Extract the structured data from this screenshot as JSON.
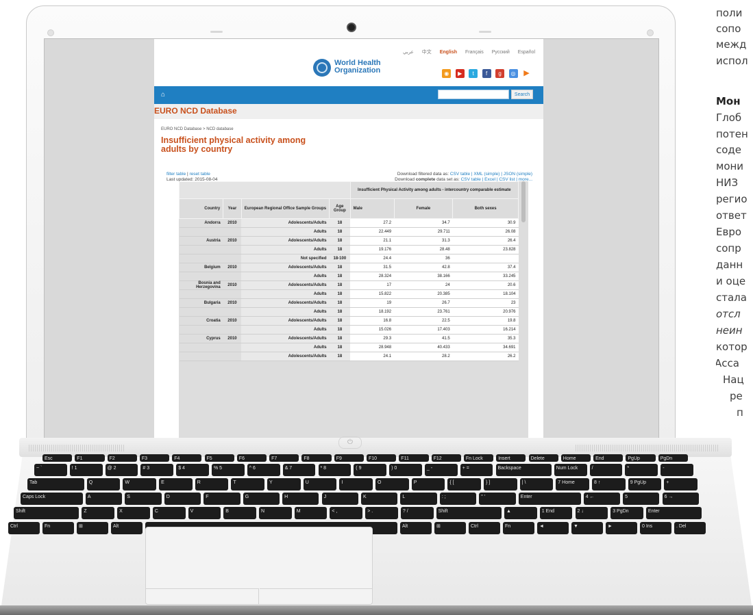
{
  "laptop": {
    "power_glyph": "⏻"
  },
  "site": {
    "languages": [
      "عربي",
      "中文",
      "English",
      "Français",
      "Русский",
      "Español"
    ],
    "active_language": "English",
    "logo_line1": "World Health",
    "logo_line2": "Organization",
    "search_placeholder": "",
    "search_button": "Search",
    "section_title": "EURO NCD Database"
  },
  "content": {
    "breadcrumb_1": "EURO NCD Database",
    "breadcrumb_sep": ">",
    "breadcrumb_2": "NCD database",
    "title": "Insufficient physical activity among adults by country",
    "filter_link": "filter table",
    "reset_link": "reset table",
    "last_updated": "Last updated: 2015-08-04",
    "download_filtered_label": "Download filtered data as:",
    "download_filtered_links": "CSV table | XML (simple) | JSON (simple)",
    "download_complete_label_pre": "Download ",
    "download_complete_bold": "complete",
    "download_complete_label_post": " data set as:",
    "download_complete_links": "CSV table | Excel | CSV list | more..."
  },
  "table": {
    "group_header": "Insufficient Physical Activity among adults - intercountry comparable estimate",
    "headers": [
      "Country",
      "Year",
      "European Regional Office Sample Groups",
      "Age Group",
      "Male",
      "Female",
      "Both sexes"
    ],
    "rows": [
      {
        "country": "Andorra",
        "year": "2010",
        "group": "Adolescents/Adults",
        "age": "18",
        "male": "27.2",
        "female": "34.7",
        "both": "30.9"
      },
      {
        "country": "",
        "year": "",
        "group": "Adults",
        "age": "18",
        "male": "22.449",
        "female": "29.711",
        "both": "26.08"
      },
      {
        "country": "Austria",
        "year": "2010",
        "group": "Adolescents/Adults",
        "age": "18",
        "male": "21.1",
        "female": "31.3",
        "both": "26.4"
      },
      {
        "country": "",
        "year": "",
        "group": "Adults",
        "age": "18",
        "male": "19.176",
        "female": "28.48",
        "both": "23.828"
      },
      {
        "country": "",
        "year": "",
        "group": "Not specified",
        "age": "18-100",
        "male": "24.4",
        "female": "36",
        "both": ""
      },
      {
        "country": "Belgium",
        "year": "2010",
        "group": "Adolescents/Adults",
        "age": "18",
        "male": "31.5",
        "female": "42.8",
        "both": "37.4"
      },
      {
        "country": "",
        "year": "",
        "group": "Adults",
        "age": "18",
        "male": "28.324",
        "female": "38.166",
        "both": "33.245"
      },
      {
        "country": "Bosnia and Herzegovina",
        "year": "2010",
        "group": "Adolescents/Adults",
        "age": "18",
        "male": "17",
        "female": "24",
        "both": "20.6"
      },
      {
        "country": "",
        "year": "",
        "group": "Adults",
        "age": "18",
        "male": "15.822",
        "female": "20.385",
        "both": "18.104"
      },
      {
        "country": "Bulgaria",
        "year": "2010",
        "group": "Adolescents/Adults",
        "age": "18",
        "male": "19",
        "female": "26.7",
        "both": "23"
      },
      {
        "country": "",
        "year": "",
        "group": "Adults",
        "age": "18",
        "male": "18.192",
        "female": "23.761",
        "both": "20.976"
      },
      {
        "country": "Croatia",
        "year": "2010",
        "group": "Adolescents/Adults",
        "age": "18",
        "male": "16.8",
        "female": "22.5",
        "both": "19.8"
      },
      {
        "country": "",
        "year": "",
        "group": "Adults",
        "age": "18",
        "male": "15.026",
        "female": "17.403",
        "both": "16.214"
      },
      {
        "country": "Cyprus",
        "year": "2010",
        "group": "Adolescents/Adults",
        "age": "18",
        "male": "29.3",
        "female": "41.5",
        "both": "35.3"
      },
      {
        "country": "",
        "year": "",
        "group": "Adults",
        "age": "18",
        "male": "28.948",
        "female": "40.433",
        "both": "34.691"
      },
      {
        "country": "",
        "year": "",
        "group": "Adolescents/Adults",
        "age": "18",
        "male": "24.1",
        "female": "28.2",
        "both": "26.2"
      }
    ]
  },
  "side_text": [
    {
      "t": "поли",
      "s": "n"
    },
    {
      "t": "сопо",
      "s": "n"
    },
    {
      "t": "межд",
      "s": "n"
    },
    {
      "t": "испол",
      "s": "n"
    },
    {
      "t": "Мон",
      "s": "b"
    },
    {
      "t": "Глоб",
      "s": "n"
    },
    {
      "t": "потен",
      "s": "n"
    },
    {
      "t": "соде",
      "s": "n"
    },
    {
      "t": "мони",
      "s": "n"
    },
    {
      "t": "НИЗ",
      "s": "n"
    },
    {
      "t": "регио",
      "s": "n"
    },
    {
      "t": "ответ",
      "s": "n"
    },
    {
      "t": "Евро",
      "s": "n"
    },
    {
      "t": "сопр",
      "s": "n"
    },
    {
      "t": "данн",
      "s": "n"
    },
    {
      "t": "и оце",
      "s": "n"
    },
    {
      "t": "стала",
      "s": "n"
    },
    {
      "t": "отсл",
      "s": "i"
    },
    {
      "t": "неин",
      "s": "i"
    },
    {
      "t": "котор",
      "s": "n"
    },
    {
      "t": "Асса",
      "s": "n"
    },
    {
      "t": "Нац",
      "s": "n"
    },
    {
      "t": "ре",
      "s": "n"
    },
    {
      "t": "п",
      "s": "n"
    }
  ],
  "keyboard": {
    "row1": [
      "Esc",
      "F1",
      "F2",
      "F3",
      "F4",
      "F5",
      "F6",
      "F7",
      "F8",
      "F9",
      "F10",
      "F11",
      "F12",
      "Fn Lock",
      "Insert",
      "Delete",
      "Home",
      "End",
      "PgUp",
      "PgDn"
    ],
    "row2": [
      "~ `",
      "! 1",
      "@ 2",
      "# 3",
      "$ 4",
      "% 5",
      "^ 6",
      "& 7",
      "* 8",
      "( 9",
      ") 0",
      "_ -",
      "+ =",
      "Backspace",
      "Num Lock",
      "/",
      "*",
      "-"
    ],
    "row3": [
      "Tab",
      "Q",
      "W",
      "E",
      "R",
      "T",
      "Y",
      "U",
      "I",
      "O",
      "P",
      "{ [",
      "} ]",
      "| \\",
      "7 Home",
      "8 ↑",
      "9 PgUp",
      "+"
    ],
    "row4": [
      "Caps Lock",
      "A",
      "S",
      "D",
      "F",
      "G",
      "H",
      "J",
      "K",
      "L",
      ": ;",
      "\" '",
      "Enter",
      "4 ←",
      "5",
      "6 →"
    ],
    "row5": [
      "Shift",
      "Z",
      "X",
      "C",
      "V",
      "B",
      "N",
      "M",
      "< ,",
      "> .",
      "? /",
      "Shift",
      "▲",
      "1 End",
      "2 ↓",
      "3 PgDn",
      "Enter"
    ],
    "row6": [
      "Ctrl",
      "Fn",
      "⊞",
      "Alt",
      "",
      "Alt",
      "⊞",
      "Ctrl",
      "Fn",
      "◄",
      "▼",
      "►",
      "0 Ins",
      ". Del"
    ]
  },
  "colors": {
    "accent_orange": "#c8501c",
    "nav_blue": "#1f7fc2"
  }
}
